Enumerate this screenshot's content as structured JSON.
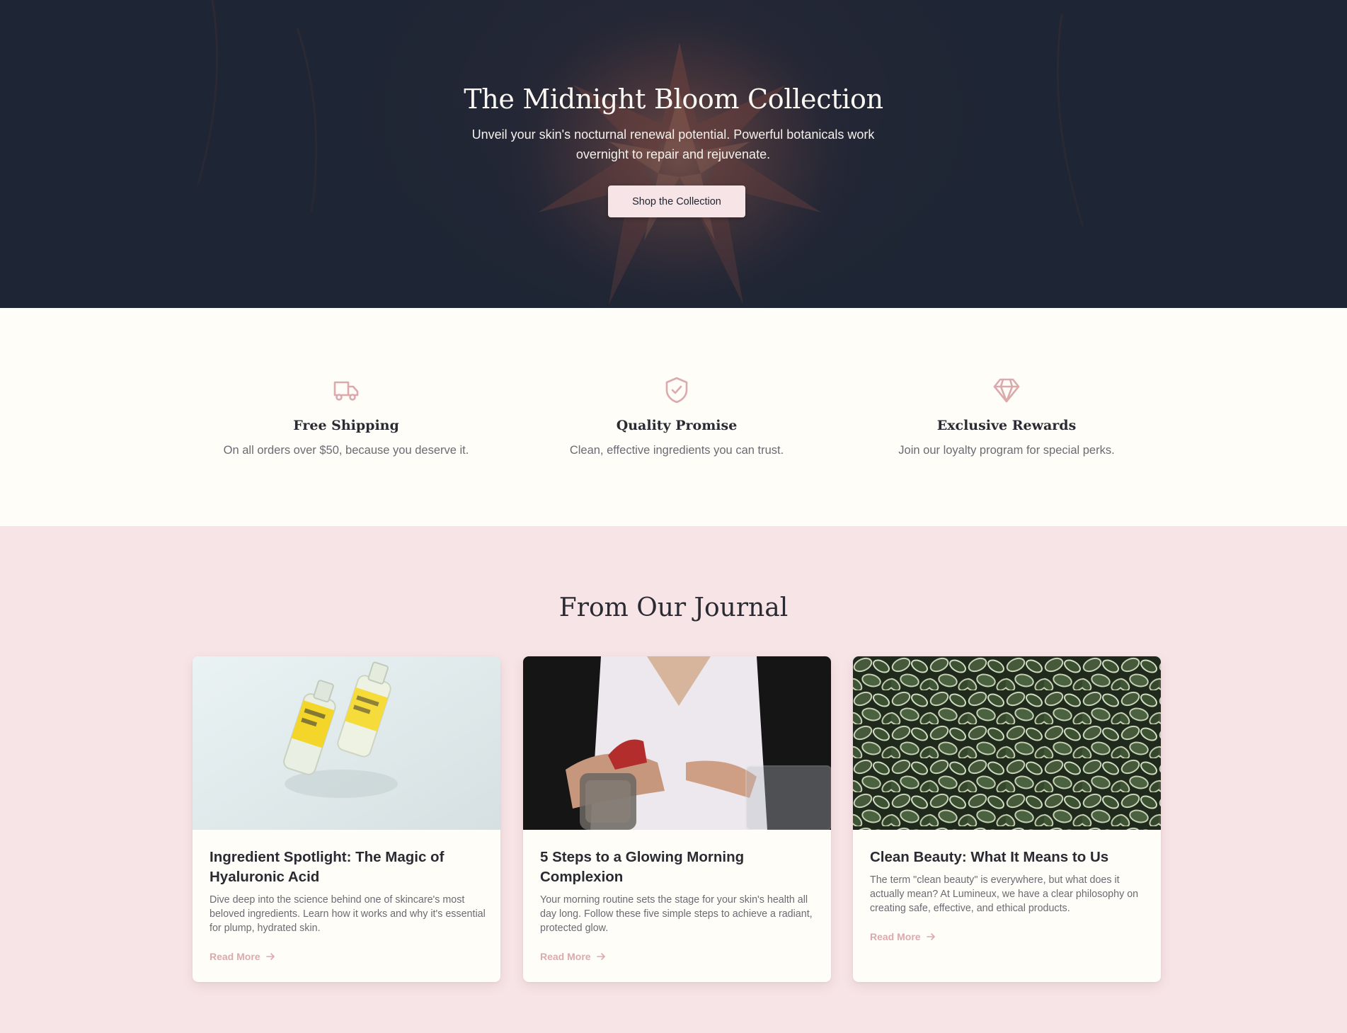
{
  "hero": {
    "title": "The Midnight Bloom Collection",
    "subtitle": "Unveil your skin's nocturnal renewal potential. Powerful botanicals work overnight to repair and rejuvenate.",
    "cta_label": "Shop the Collection"
  },
  "features": [
    {
      "icon": "truck-icon",
      "title": "Free Shipping",
      "text": "On all orders over $50, because you deserve it."
    },
    {
      "icon": "shield-check-icon",
      "title": "Quality Promise",
      "text": "Clean, effective ingredients you can trust."
    },
    {
      "icon": "diamond-icon",
      "title": "Exclusive Rewards",
      "text": "Join our loyalty program for special perks."
    }
  ],
  "journal": {
    "title": "From Our Journal",
    "posts": [
      {
        "title": "Ingredient Spotlight: The Magic of Hyaluronic Acid",
        "excerpt": "Dive deep into the science behind one of skincare's most beloved ingredients. Learn how it works and why it's essential for plump, hydrated skin.",
        "read_more": "Read More",
        "image": "serum-bottles-photo"
      },
      {
        "title": "5 Steps to a Glowing Morning Complexion",
        "excerpt": "Your morning routine sets the stage for your skin's health all day long. Follow these five simple steps to achieve a radiant, protected glow.",
        "read_more": "Read More",
        "image": "morning-routine-photo"
      },
      {
        "title": "Clean Beauty: What It Means to Us",
        "excerpt": "The term \"clean beauty\" is everywhere, but what does it actually mean? At Lumineux, we have a clear philosophy on creating safe, effective, and ethical products.",
        "read_more": "Read More",
        "image": "green-leaves-photo"
      }
    ]
  },
  "colors": {
    "hero_bg": "#1e2534",
    "cream": "#fefdf7",
    "blush": "#f7e4e6",
    "accent": "#dca9ad",
    "text_dark": "#2a2a33",
    "text_muted": "#6b6b73"
  }
}
